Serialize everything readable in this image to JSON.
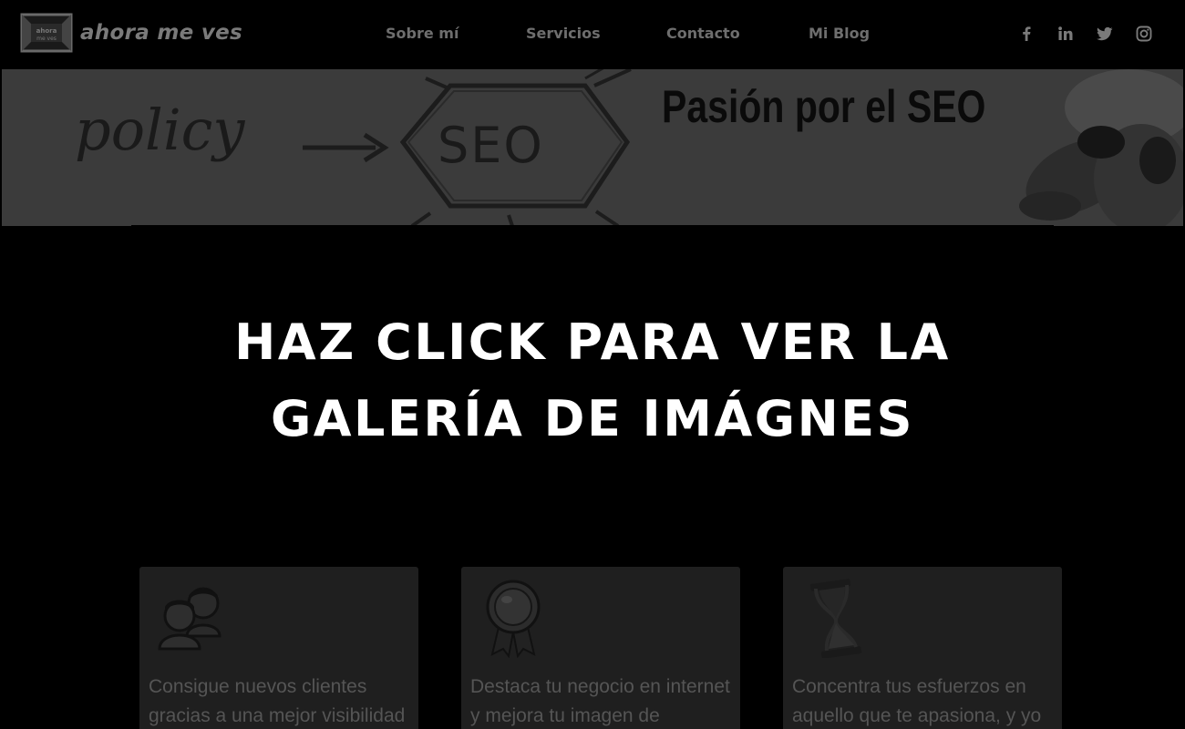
{
  "header": {
    "logo_text": "ahora me ves",
    "nav": [
      {
        "label": "Sobre mí"
      },
      {
        "label": "Servicios"
      },
      {
        "label": "Contacto"
      },
      {
        "label": "Mi Blog"
      }
    ],
    "social": [
      {
        "icon": "facebook-icon"
      },
      {
        "icon": "linkedin-icon"
      },
      {
        "icon": "twitter-icon"
      },
      {
        "icon": "instagram-icon"
      }
    ]
  },
  "banner": {
    "word_left": "policy",
    "word_center": "SEO",
    "headline": "Pasión por el SEO"
  },
  "overlay": {
    "line1": "HAZ CLICK PARA VER LA",
    "line2": "GALERÍA DE IMÁGNES"
  },
  "cards": [
    {
      "icon": "users-icon",
      "text": "Consigue nuevos clientes gracias a una mejor visibilidad"
    },
    {
      "icon": "award-medal-icon",
      "text": "Destaca tu negocio en internet y mejora tu imagen de"
    },
    {
      "icon": "hourglass-icon",
      "text": "Concentra tus esfuerzos en aquello que te apasiona, y yo"
    }
  ],
  "colors": {
    "background": "#000000",
    "header_text": "#6e6e6e",
    "overlay_text": "#ffffff",
    "card_bg": "#1f1f1f"
  }
}
